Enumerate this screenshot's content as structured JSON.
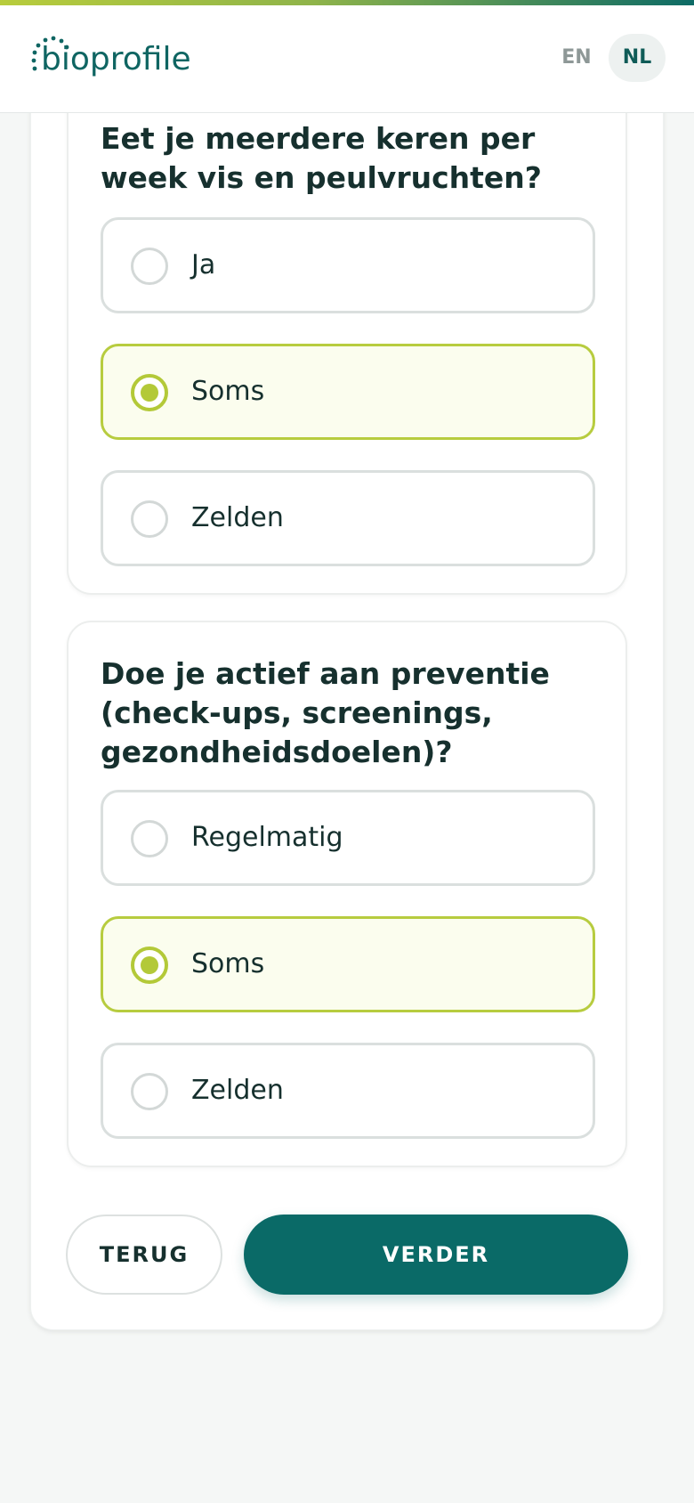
{
  "brand": {
    "name": "bioprofile",
    "accent": "#0a6a67",
    "highlight": "#b7cc3f"
  },
  "header": {
    "languages": [
      {
        "code": "EN",
        "active": false
      },
      {
        "code": "NL",
        "active": true
      }
    ]
  },
  "questions": [
    {
      "text": "Eet je meerdere keren per week vis en peulvruchten?",
      "options": [
        {
          "label": "Ja",
          "selected": false
        },
        {
          "label": "Soms",
          "selected": true
        },
        {
          "label": "Zelden",
          "selected": false
        }
      ]
    },
    {
      "text": "Doe je actief aan preventie (check-ups, screenings, gezondheidsdoelen)?",
      "options": [
        {
          "label": "Regelmatig",
          "selected": false
        },
        {
          "label": "Soms",
          "selected": true
        },
        {
          "label": "Zelden",
          "selected": false
        }
      ]
    }
  ],
  "actions": {
    "back_label": "TERUG",
    "next_label": "VERDER"
  }
}
